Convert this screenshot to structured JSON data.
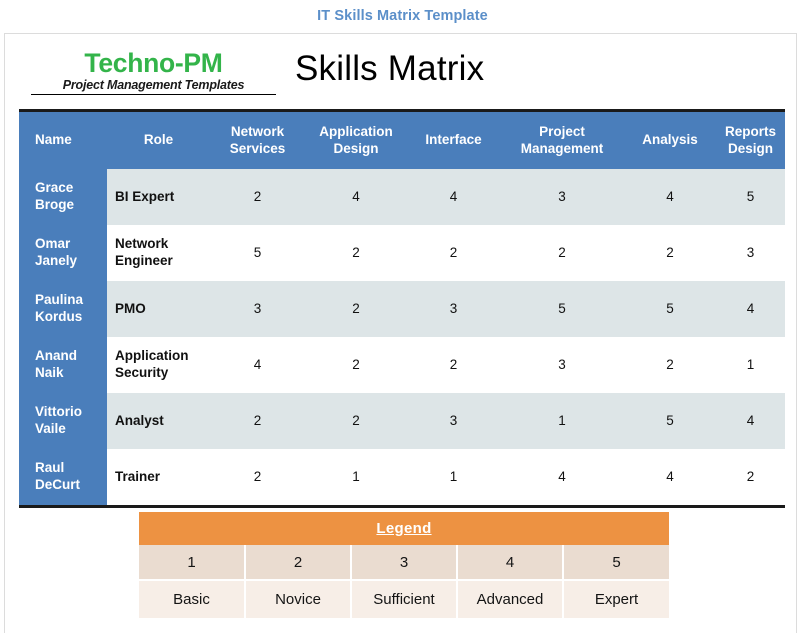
{
  "document": {
    "template_title": "IT Skills Matrix Template",
    "heading": "Skills Matrix",
    "accent_blue": "#4A7EBB",
    "title_blue": "#5B8FC9",
    "legend_orange": "#ED9242",
    "row_stripe": "#DDE5E7",
    "logo_green": "#33B44A"
  },
  "logo": {
    "name": "Techno-PM",
    "tagline": "Project Management Templates"
  },
  "matrix": {
    "columns": [
      {
        "key": "name",
        "label": "Name"
      },
      {
        "key": "role",
        "label": "Role"
      },
      {
        "key": "network_services",
        "label": "Network Services"
      },
      {
        "key": "application_design",
        "label": "Application Design"
      },
      {
        "key": "interface",
        "label": "Interface"
      },
      {
        "key": "project_management",
        "label": "Project Management"
      },
      {
        "key": "analysis",
        "label": "Analysis"
      },
      {
        "key": "reports_design",
        "label": "Reports Design"
      }
    ],
    "rows": [
      {
        "name": "Grace Broge",
        "role": "BI Expert",
        "network_services": "2",
        "application_design": "4",
        "interface": "4",
        "project_management": "3",
        "analysis": "4",
        "reports_design": "5"
      },
      {
        "name": "Omar Janely",
        "role": "Network Engineer",
        "network_services": "5",
        "application_design": "2",
        "interface": "2",
        "project_management": "2",
        "analysis": "2",
        "reports_design": "3"
      },
      {
        "name": "Paulina Kordus",
        "role": "PMO",
        "network_services": "3",
        "application_design": "2",
        "interface": "3",
        "project_management": "5",
        "analysis": "5",
        "reports_design": "4"
      },
      {
        "name": "Anand Naik",
        "role": "Application Security",
        "network_services": "4",
        "application_design": "2",
        "interface": "2",
        "project_management": "3",
        "analysis": "2",
        "reports_design": "1"
      },
      {
        "name": "Vittorio Vaile",
        "role": "Analyst",
        "network_services": "2",
        "application_design": "2",
        "interface": "3",
        "project_management": "1",
        "analysis": "5",
        "reports_design": "4"
      },
      {
        "name": "Raul DeCurt",
        "role": "Trainer",
        "network_services": "2",
        "application_design": "1",
        "interface": "1",
        "project_management": "4",
        "analysis": "4",
        "reports_design": "2"
      }
    ]
  },
  "legend": {
    "title": "Legend",
    "levels": [
      {
        "value": "1",
        "label": "Basic"
      },
      {
        "value": "2",
        "label": "Novice"
      },
      {
        "value": "3",
        "label": "Sufficient"
      },
      {
        "value": "4",
        "label": "Advanced"
      },
      {
        "value": "5",
        "label": "Expert"
      }
    ]
  }
}
